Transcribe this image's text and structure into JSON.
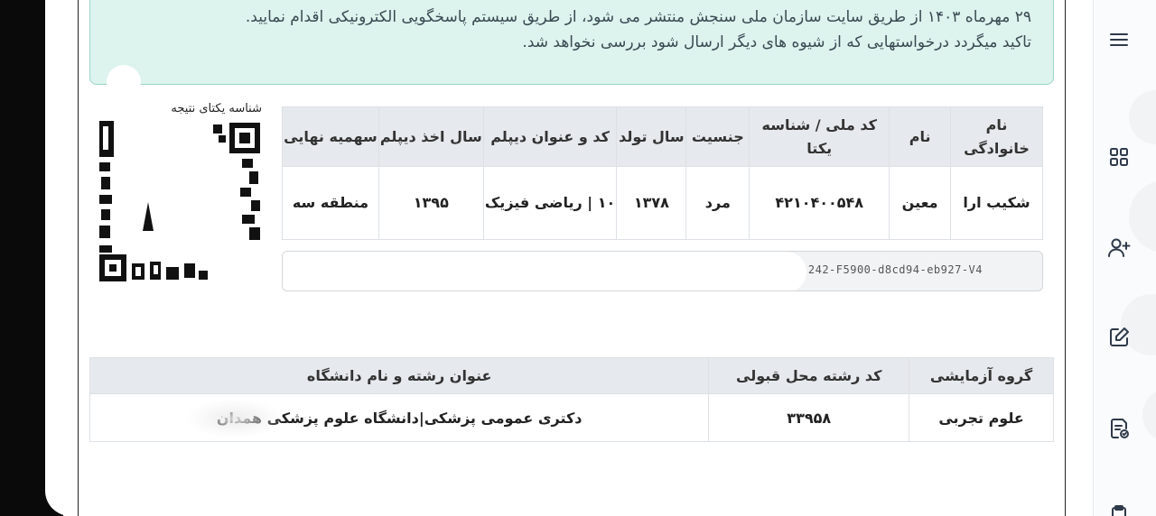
{
  "notice": {
    "line1": "۲۹ مهرماه ۱۴۰۳ از طریق سایت سازمان ملی سنجش منتشر می شود، از طریق سیستم پاسخگویی الکترونیکی اقدام نمایید.",
    "line2": "تاکید میگردد درخواستهایی که از شیوه های دیگر ارسال شود بررسی نخواهد شد."
  },
  "qr": {
    "label": "شناسه یکتای نتیجه"
  },
  "result_table": {
    "headers": [
      "نام خانوادگی",
      "نام",
      "کد ملی / شناسه یکتا",
      "جنسیت",
      "سال تولد",
      "کد و عنوان دیپلم",
      "سال اخذ دیپلم",
      "سهمیه نهایی"
    ],
    "row": [
      "شکیب ارا",
      "معین",
      "۴۲۱۰۴۰۰۵۴۸",
      "مرد",
      "۱۳۷۸",
      "۱۰ | ریاضی فیزیک",
      "۱۳۹۵",
      "منطقه سه"
    ]
  },
  "tracking_code": "242-F5900-d8cd94-eb927-V4",
  "admission_table": {
    "headers": [
      "گروه آزمایشی",
      "کد رشته محل قبولی",
      "عنوان رشته و نام دانشگاه"
    ],
    "row": [
      "علوم تجربی",
      "۳۳۹۵۸",
      "دکتری عمومی پزشکی|دانشگاه علوم پزشکی همدان"
    ]
  },
  "sidebar": {
    "icons": [
      "menu-icon",
      "dashboard-icon",
      "add-user-icon",
      "edit-icon",
      "document-check-icon",
      "clipboard-icon"
    ]
  }
}
